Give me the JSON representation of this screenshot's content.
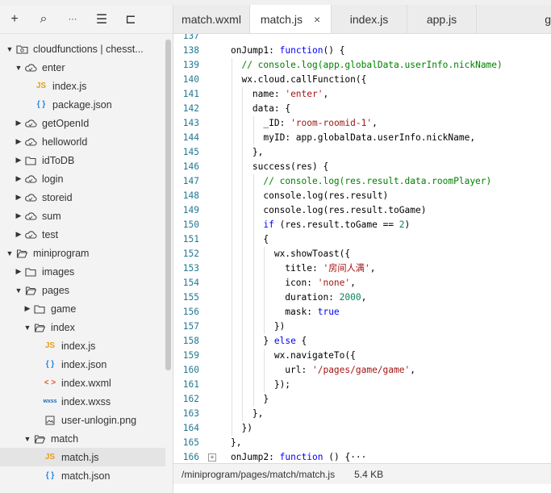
{
  "sidebar": {
    "toolbar": [
      {
        "name": "add-icon",
        "glyph": "+"
      },
      {
        "name": "search-icon",
        "glyph": "⌕"
      },
      {
        "name": "more-icon",
        "glyph": "···"
      },
      {
        "name": "sort-icon",
        "glyph": "☰"
      },
      {
        "name": "collapse-icon",
        "glyph": "⊏"
      }
    ],
    "tree": [
      {
        "label": "cloudfunctions | chesst...",
        "depth": 0,
        "arrow": "down",
        "icon": "folder-cloud"
      },
      {
        "label": "enter",
        "depth": 1,
        "arrow": "down",
        "icon": "cloud"
      },
      {
        "label": "index.js",
        "depth": 2,
        "arrow": "",
        "icon": "js"
      },
      {
        "label": "package.json",
        "depth": 2,
        "arrow": "",
        "icon": "json"
      },
      {
        "label": "getOpenId",
        "depth": 1,
        "arrow": "right",
        "icon": "cloud"
      },
      {
        "label": "helloworld",
        "depth": 1,
        "arrow": "right",
        "icon": "cloud"
      },
      {
        "label": "idToDB",
        "depth": 1,
        "arrow": "right",
        "icon": "folder"
      },
      {
        "label": "login",
        "depth": 1,
        "arrow": "right",
        "icon": "cloud"
      },
      {
        "label": "storeid",
        "depth": 1,
        "arrow": "right",
        "icon": "cloud"
      },
      {
        "label": "sum",
        "depth": 1,
        "arrow": "right",
        "icon": "cloud"
      },
      {
        "label": "test",
        "depth": 1,
        "arrow": "right",
        "icon": "cloud"
      },
      {
        "label": "miniprogram",
        "depth": 0,
        "arrow": "down",
        "icon": "folder-open"
      },
      {
        "label": "images",
        "depth": 1,
        "arrow": "right",
        "icon": "folder"
      },
      {
        "label": "pages",
        "depth": 1,
        "arrow": "down",
        "icon": "folder-open"
      },
      {
        "label": "game",
        "depth": 2,
        "arrow": "right",
        "icon": "folder"
      },
      {
        "label": "index",
        "depth": 2,
        "arrow": "down",
        "icon": "folder-open"
      },
      {
        "label": "index.js",
        "depth": 3,
        "arrow": "",
        "icon": "js"
      },
      {
        "label": "index.json",
        "depth": 3,
        "arrow": "",
        "icon": "json"
      },
      {
        "label": "index.wxml",
        "depth": 3,
        "arrow": "",
        "icon": "wxml"
      },
      {
        "label": "index.wxss",
        "depth": 3,
        "arrow": "",
        "icon": "wxss"
      },
      {
        "label": "user-unlogin.png",
        "depth": 3,
        "arrow": "",
        "icon": "png"
      },
      {
        "label": "match",
        "depth": 2,
        "arrow": "down",
        "icon": "folder-open"
      },
      {
        "label": "match.js",
        "depth": 3,
        "arrow": "",
        "icon": "js",
        "selected": true
      },
      {
        "label": "match.json",
        "depth": 3,
        "arrow": "",
        "icon": "json"
      }
    ]
  },
  "icon_glyphs": {
    "js": "JS",
    "json": "{ }",
    "wxml": "< >",
    "wxss": "wxss"
  },
  "tabs": [
    {
      "label": "match.wxml",
      "active": false
    },
    {
      "label": "match.js",
      "active": true
    },
    {
      "label": "index.js",
      "active": false
    },
    {
      "label": "app.js",
      "active": false
    },
    {
      "label": "g",
      "active": false
    }
  ],
  "close_glyph": "×",
  "fold_glyph": "+",
  "code_lines": [
    {
      "n": "137",
      "indent": 0,
      "tokens": []
    },
    {
      "n": "138",
      "indent": 0,
      "tokens": [
        [
          "",
          "onJump1: "
        ],
        [
          "k",
          "function"
        ],
        [
          "",
          "() {"
        ]
      ]
    },
    {
      "n": "139",
      "indent": 1,
      "tokens": [
        [
          "c",
          "// console.log(app.globalData.userInfo.nickName)"
        ]
      ]
    },
    {
      "n": "140",
      "indent": 1,
      "tokens": [
        [
          "",
          "wx.cloud.callFunction({"
        ]
      ]
    },
    {
      "n": "141",
      "indent": 2,
      "tokens": [
        [
          "",
          "name: "
        ],
        [
          "s",
          "'enter'"
        ],
        [
          "",
          ","
        ]
      ]
    },
    {
      "n": "142",
      "indent": 2,
      "tokens": [
        [
          "",
          "data: {"
        ]
      ]
    },
    {
      "n": "143",
      "indent": 3,
      "tokens": [
        [
          "",
          "_ID: "
        ],
        [
          "s",
          "'room-roomid-1'"
        ],
        [
          "",
          ","
        ]
      ]
    },
    {
      "n": "144",
      "indent": 3,
      "tokens": [
        [
          "",
          "myID: app.globalData.userInfo.nickName,"
        ]
      ]
    },
    {
      "n": "145",
      "indent": 2,
      "tokens": [
        [
          "",
          "},"
        ]
      ]
    },
    {
      "n": "146",
      "indent": 2,
      "tokens": [
        [
          "",
          "success(res) {"
        ]
      ]
    },
    {
      "n": "147",
      "indent": 3,
      "tokens": [
        [
          "c",
          "// console.log(res.result.data.roomPlayer)"
        ]
      ]
    },
    {
      "n": "148",
      "indent": 3,
      "tokens": [
        [
          "",
          "console.log(res.result)"
        ]
      ]
    },
    {
      "n": "149",
      "indent": 3,
      "tokens": [
        [
          "",
          "console.log(res.result.toGame)"
        ]
      ]
    },
    {
      "n": "150",
      "indent": 3,
      "tokens": [
        [
          "k",
          "if"
        ],
        [
          "",
          " (res.result.toGame == "
        ],
        [
          "n",
          "2"
        ],
        [
          "",
          ")"
        ]
      ]
    },
    {
      "n": "151",
      "indent": 3,
      "tokens": [
        [
          "",
          "{"
        ]
      ]
    },
    {
      "n": "152",
      "indent": 4,
      "tokens": [
        [
          "",
          "wx.showToast({"
        ]
      ]
    },
    {
      "n": "153",
      "indent": 5,
      "tokens": [
        [
          "",
          "title: "
        ],
        [
          "s",
          "'房间人满'"
        ],
        [
          "",
          ","
        ]
      ]
    },
    {
      "n": "154",
      "indent": 5,
      "tokens": [
        [
          "",
          "icon: "
        ],
        [
          "s",
          "'none'"
        ],
        [
          "",
          ","
        ]
      ]
    },
    {
      "n": "155",
      "indent": 5,
      "tokens": [
        [
          "",
          "duration: "
        ],
        [
          "n",
          "2000"
        ],
        [
          "",
          ","
        ]
      ]
    },
    {
      "n": "156",
      "indent": 5,
      "tokens": [
        [
          "",
          "mask: "
        ],
        [
          "k",
          "true"
        ]
      ]
    },
    {
      "n": "157",
      "indent": 4,
      "tokens": [
        [
          "",
          "})"
        ]
      ]
    },
    {
      "n": "158",
      "indent": 3,
      "tokens": [
        [
          "",
          "} "
        ],
        [
          "k",
          "else"
        ],
        [
          "",
          " {"
        ]
      ]
    },
    {
      "n": "159",
      "indent": 4,
      "tokens": [
        [
          "",
          "wx.navigateTo({"
        ]
      ]
    },
    {
      "n": "160",
      "indent": 5,
      "tokens": [
        [
          "",
          "url: "
        ],
        [
          "s",
          "'/pages/game/game'"
        ],
        [
          "",
          ","
        ]
      ]
    },
    {
      "n": "161",
      "indent": 4,
      "tokens": [
        [
          "",
          "});"
        ]
      ]
    },
    {
      "n": "162",
      "indent": 3,
      "tokens": [
        [
          "",
          "}"
        ]
      ]
    },
    {
      "n": "163",
      "indent": 2,
      "tokens": [
        [
          "",
          "},"
        ]
      ]
    },
    {
      "n": "164",
      "indent": 1,
      "tokens": [
        [
          "",
          "})"
        ]
      ]
    },
    {
      "n": "165",
      "indent": 0,
      "tokens": [
        [
          "",
          "},"
        ]
      ]
    },
    {
      "n": "166",
      "indent": 0,
      "fold": true,
      "tokens": [
        [
          "",
          "onJump2: "
        ],
        [
          "k",
          "function"
        ],
        [
          "",
          " () {···"
        ]
      ]
    }
  ],
  "status": {
    "path": "/miniprogram/pages/match/match.js",
    "size": "5.4 KB"
  }
}
